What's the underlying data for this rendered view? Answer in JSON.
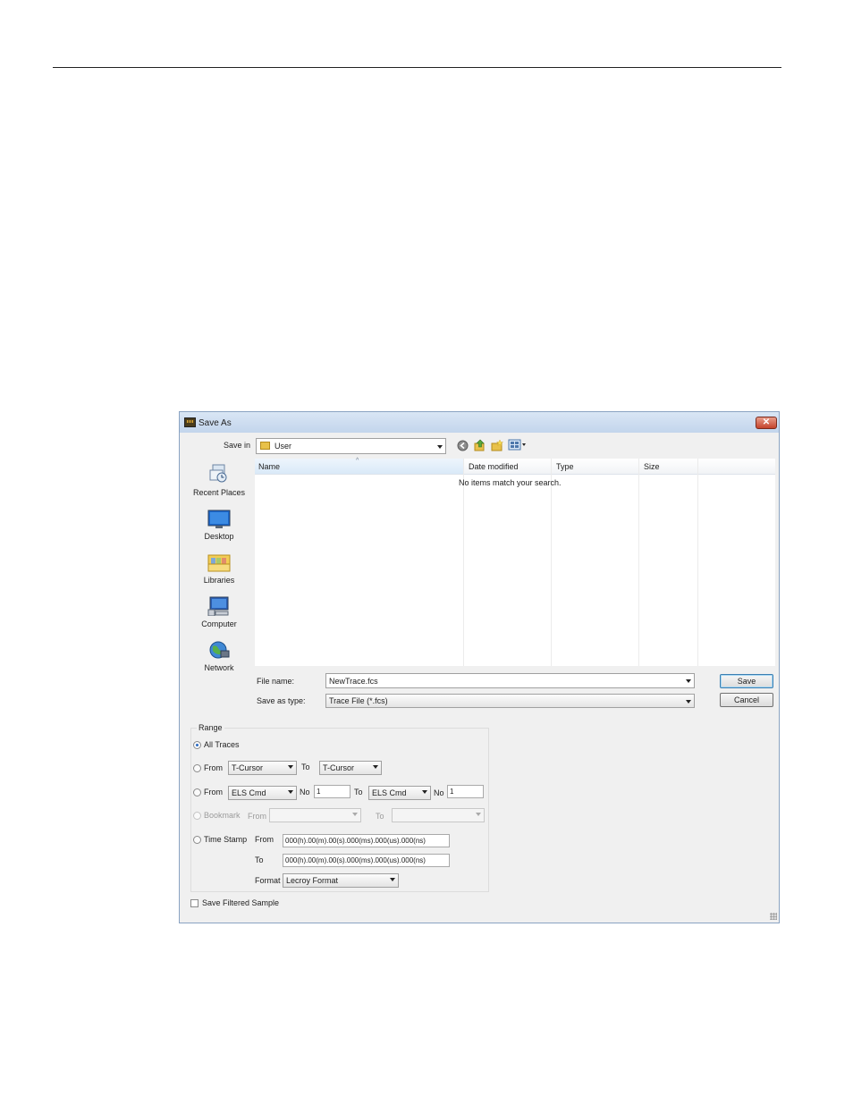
{
  "dialog": {
    "title": "Save As",
    "close_glyph": "✕",
    "save_in_label": "Save in",
    "save_in_value": "User",
    "toolbar_icons": [
      "back-icon",
      "up-folder-icon",
      "new-folder-icon",
      "views-menu-icon"
    ]
  },
  "places": [
    {
      "label": "Recent Places",
      "icon": "recent-places-icon"
    },
    {
      "label": "Desktop",
      "icon": "desktop-icon"
    },
    {
      "label": "Libraries",
      "icon": "libraries-icon"
    },
    {
      "label": "Computer",
      "icon": "computer-icon"
    },
    {
      "label": "Network",
      "icon": "network-icon"
    }
  ],
  "file_list": {
    "columns": [
      "Name",
      "Date modified",
      "Type",
      "Size"
    ],
    "empty_message": "No items match your search."
  },
  "file_name": {
    "label": "File name:",
    "value": "NewTrace.fcs"
  },
  "save_as_type": {
    "label": "Save as type:",
    "value": "Trace File (*.fcs)"
  },
  "buttons": {
    "save": "Save",
    "cancel": "Cancel"
  },
  "range": {
    "group_label": "Range",
    "all_traces": "All Traces",
    "from_label": "From",
    "to_label": "To",
    "no_label": "No",
    "cursor_from": "T-Cursor",
    "cursor_to": "T-Cursor",
    "els_from": "ELS Cmd",
    "els_from_no": "1",
    "els_to": "ELS Cmd",
    "els_to_no": "1",
    "bookmark_label": "Bookmark",
    "timestamp_label": "Time Stamp",
    "ts_from_value": "000(h).00(m).00(s).000(ms).000(us).000(ns)",
    "ts_to_value": "000(h).00(m).00(s).000(ms).000(us).000(ns)",
    "format_label": "Format",
    "format_value": "Lecroy Format"
  },
  "save_filtered_label": "Save Filtered Sample",
  "colors": {
    "title_bar": "#c9daf0",
    "close_button": "#c4432b",
    "radio_selected": "#2a6bc4"
  }
}
